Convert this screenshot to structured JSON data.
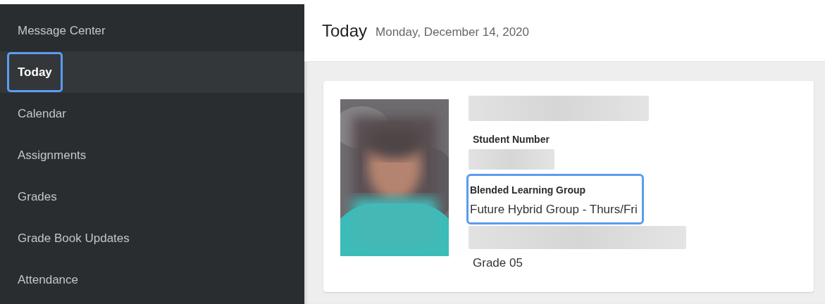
{
  "sidebar": {
    "items": [
      {
        "label": "Message Center",
        "selected": false
      },
      {
        "label": "Today",
        "selected": true
      },
      {
        "label": "Calendar",
        "selected": false
      },
      {
        "label": "Assignments",
        "selected": false
      },
      {
        "label": "Grades",
        "selected": false
      },
      {
        "label": "Grade Book Updates",
        "selected": false
      },
      {
        "label": "Attendance",
        "selected": false
      }
    ]
  },
  "header": {
    "title": "Today",
    "date": "Monday, December 14, 2020"
  },
  "student_card": {
    "fields": [
      {
        "kind": "redacted"
      },
      {
        "kind": "label",
        "text": "Student Number"
      },
      {
        "kind": "redacted"
      },
      {
        "kind": "group",
        "label": "Blended Learning Group",
        "value": "Future Hybrid Group - Thurs/Fri",
        "highlighted": true
      },
      {
        "kind": "redacted"
      },
      {
        "kind": "value",
        "text": "Grade 05"
      }
    ]
  }
}
